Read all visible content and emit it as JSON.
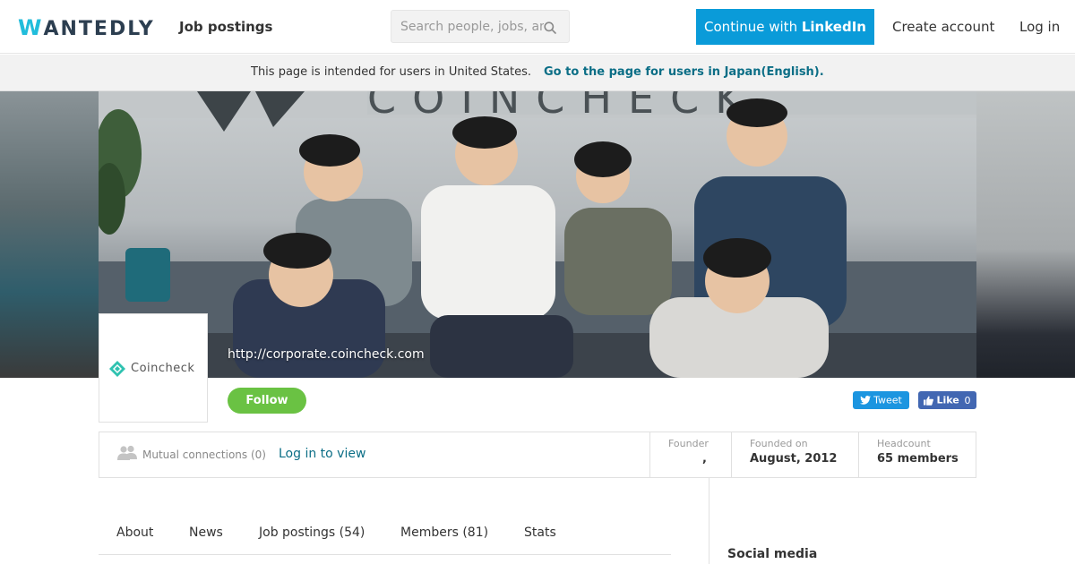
{
  "header": {
    "logo": "WANTEDLY",
    "nav_job_postings": "Job postings",
    "search_placeholder": "Search people, jobs, and companies",
    "linkedin_prefix": "Continue with ",
    "linkedin_brand": "LinkedIn",
    "create_account": "Create account",
    "log_in": "Log in"
  },
  "notice": {
    "text": "This page is intended for users in United States.",
    "link": "Go to the page for users in Japan(English)."
  },
  "company": {
    "logo_name": "Coincheck",
    "url": "http://corporate.coincheck.com",
    "follow_label": "Follow"
  },
  "social_buttons": {
    "tweet": "Tweet",
    "like": "Like",
    "like_count": "0"
  },
  "info": {
    "mutual_label": "Mutual connections (0)",
    "mutual_link": "Log in to view",
    "founder_label": "Founder",
    "founder_value": ",",
    "founded_label": "Founded on",
    "founded_value": "August, 2012",
    "headcount_label": "Headcount",
    "headcount_value": "65 members"
  },
  "tabs": [
    {
      "label": "About"
    },
    {
      "label": "News"
    },
    {
      "label": "Job postings (54)"
    },
    {
      "label": "Members (81)"
    },
    {
      "label": "Stats"
    }
  ],
  "sidebar": {
    "social_media_heading": "Social media"
  },
  "colors": {
    "linkedin_button": "#0a9bd9",
    "follow_button": "#6ac243",
    "link": "#0b6e86",
    "tweet_button": "#1b95e0",
    "like_button": "#4267b2",
    "logo_accent": "#21bddb"
  }
}
